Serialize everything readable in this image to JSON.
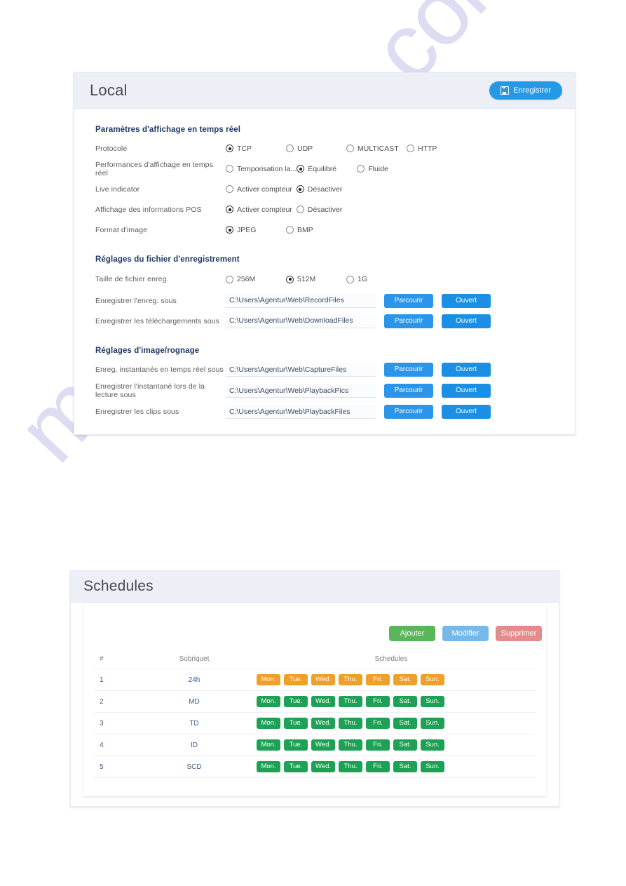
{
  "local": {
    "title": "Local",
    "save_label": "Enregistrer",
    "sections": {
      "display": "Paramètres d'affichage en temps réel",
      "record": "Réglages du fichier d'enregistrement",
      "image": "Réglages d'image/rognage"
    },
    "rows": {
      "protocol": {
        "label": "Protocole",
        "options": [
          "TCP",
          "UDP",
          "MULTICAST",
          "HTTP"
        ],
        "selected": "TCP"
      },
      "performance": {
        "label": "Performances d'affichage en temps réel",
        "options": [
          "Temporisation la...",
          "Équilibré",
          "Fluide"
        ],
        "selected": "Équilibré"
      },
      "live_indicator": {
        "label": "Live indicator",
        "options": [
          "Activer compteur",
          "Désactiver"
        ],
        "selected": "Désactiver"
      },
      "pos": {
        "label": "Affichage des informations POS",
        "options": [
          "Activer compteur",
          "Désactiver"
        ],
        "selected": "Activer compteur"
      },
      "image_format": {
        "label": "Format d'image",
        "options": [
          "JPEG",
          "BMP"
        ],
        "selected": "JPEG"
      },
      "file_size": {
        "label": "Taille de fichier enreg.",
        "options": [
          "256M",
          "512M",
          "1G"
        ],
        "selected": "512M"
      },
      "record_path": {
        "label": "Enregistrer l'enreg. sous",
        "value": "C:\\Users\\Agentur\\Web\\RecordFiles"
      },
      "download_path": {
        "label": "Enregistrer les téléchargements sous",
        "value": "C:\\Users\\Agentur\\Web\\DownloadFiles"
      },
      "capture_path": {
        "label": "Enreg. instantanés en temps réel sous",
        "value": "C:\\Users\\Agentur\\Web\\CaptureFiles"
      },
      "playbackpics_path": {
        "label": "Enregistrer l'instantané lors de la lecture sous",
        "value": "C:\\Users\\Agentur\\Web\\PlaybackPics"
      },
      "playbackfiles_path": {
        "label": "Enregistrer les clips sous",
        "value": "C:\\Users\\Agentur\\Web\\PlaybackFiles"
      }
    },
    "browse_label": "Parcourir",
    "open_label": "Ouvert"
  },
  "schedules": {
    "title": "Schedules",
    "actions": {
      "add": "Ajouter",
      "edit": "Modifier",
      "delete": "Supprimer"
    },
    "columns": [
      "#",
      "Sobriquet",
      "Schedules"
    ],
    "days": [
      "Mon.",
      "Tue.",
      "Wed.",
      "Thu.",
      "Fri.",
      "Sat.",
      "Sun."
    ],
    "rows": [
      {
        "idx": "1",
        "nickname": "24h",
        "color": "orange"
      },
      {
        "idx": "2",
        "nickname": "MD",
        "color": "green"
      },
      {
        "idx": "3",
        "nickname": "TD",
        "color": "green"
      },
      {
        "idx": "4",
        "nickname": "ID",
        "color": "green"
      },
      {
        "idx": "5",
        "nickname": "SCD",
        "color": "green"
      }
    ]
  },
  "watermark": {
    "text": "manualshive.com"
  },
  "colors": {
    "accent_blue": "#2699e6",
    "section_heading": "#1f3864",
    "panel_header_bg": "#eceff5",
    "add_green": "#59b659",
    "edit_blue": "#74b9ea",
    "delete_red": "#e48b8b",
    "day_orange": "#efa02b",
    "day_green": "#1ea154"
  }
}
